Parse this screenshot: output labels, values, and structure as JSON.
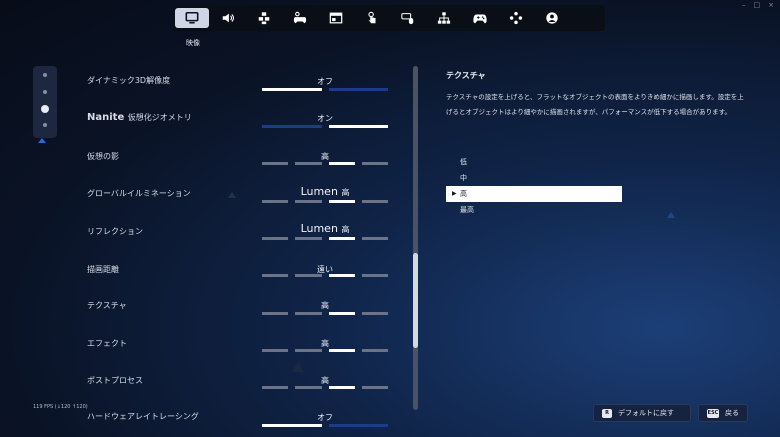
{
  "window": {
    "minimize": "–",
    "maximize": "□",
    "close": "×"
  },
  "tabs": [
    {
      "icon": "monitor-icon",
      "active": true
    },
    {
      "icon": "speaker-icon",
      "active": false
    },
    {
      "icon": "accessibility-icon",
      "active": false
    },
    {
      "icon": "gamepad-settings-icon",
      "active": false
    },
    {
      "icon": "window-layout-icon",
      "active": false
    },
    {
      "icon": "touch-icon",
      "active": false
    },
    {
      "icon": "keyboard-mouse-icon",
      "active": false
    },
    {
      "icon": "network-icon",
      "active": false
    },
    {
      "icon": "gamepad-icon",
      "active": false
    },
    {
      "icon": "dpad-icon",
      "active": false
    },
    {
      "icon": "account-icon",
      "active": false
    }
  ],
  "active_tab_caption": "映像",
  "settings": [
    {
      "label": "ダイナミック3D解像度",
      "value": "オフ",
      "segments": 2,
      "selected": 0
    },
    {
      "label": "Nanite",
      "label_sub": "仮想化ジオメトリ",
      "value": "オン",
      "segments": 2,
      "selected": 1
    },
    {
      "label": "仮想の影",
      "value": "高",
      "segments": 4,
      "selected": 2
    },
    {
      "label": "グローバルイルミネーション",
      "value": "Lumen",
      "value_sub": "高",
      "segments": 4,
      "selected": 2
    },
    {
      "label": "リフレクション",
      "value": "Lumen",
      "value_sub": "高",
      "segments": 4,
      "selected": 2
    },
    {
      "label": "描画距離",
      "value": "遠い",
      "segments": 4,
      "selected": 2
    },
    {
      "label": "テクスチャ",
      "value": "高",
      "segments": 4,
      "selected": 2
    },
    {
      "label": "エフェクト",
      "value": "高",
      "segments": 4,
      "selected": 2
    },
    {
      "label": "ポストプロセス",
      "value": "高",
      "segments": 4,
      "selected": 2
    },
    {
      "label": "ハードウェアレイトレーシング",
      "value": "オフ",
      "segments": 2,
      "selected": 0
    }
  ],
  "pager": {
    "count": 4,
    "active": 2
  },
  "scroll": {
    "position": 0.54,
    "visible_fraction": 0.28
  },
  "detail": {
    "title": "テクスチャ",
    "body": "テクスチャの設定を上げると、フラットなオブジェクトの表面をよりきめ細かに描画します。設定を上げるとオブジェクトはより細やかに描画されますが、パフォーマンスが低下する場合があります。",
    "options": [
      "低",
      "中",
      "高",
      "最高"
    ],
    "selected_index": 2,
    "selected_caret": "▶"
  },
  "fps": "119 FPS (↓120 ↑120)",
  "footer": {
    "reset_key": "R",
    "reset_label": "デフォルトに戻す",
    "back_key": "ESC",
    "back_label": "戻る"
  },
  "colors": {
    "segment_on": "#ffffff",
    "segment_idle": "#6b7386",
    "segment_unselected_toggle": "#1b3c88",
    "accent": "#2c6ad8"
  }
}
